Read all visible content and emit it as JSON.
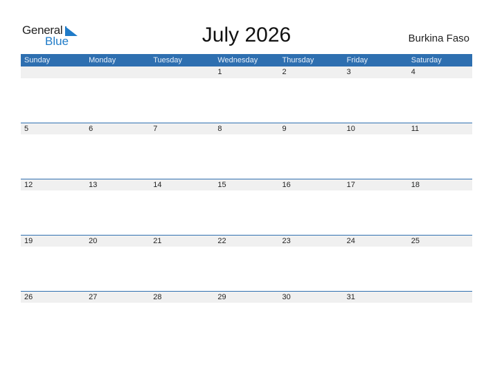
{
  "logo": {
    "word1": "General",
    "word2": "Blue"
  },
  "title": "July 2026",
  "country": "Burkina Faso",
  "colors": {
    "accent": "#2e6fb0",
    "logo_blue": "#1f7bc8",
    "strip": "#f0f0f0"
  },
  "days": [
    "Sunday",
    "Monday",
    "Tuesday",
    "Wednesday",
    "Thursday",
    "Friday",
    "Saturday"
  ],
  "weeks": [
    [
      "",
      "",
      "",
      "1",
      "2",
      "3",
      "4"
    ],
    [
      "5",
      "6",
      "7",
      "8",
      "9",
      "10",
      "11"
    ],
    [
      "12",
      "13",
      "14",
      "15",
      "16",
      "17",
      "18"
    ],
    [
      "19",
      "20",
      "21",
      "22",
      "23",
      "24",
      "25"
    ],
    [
      "26",
      "27",
      "28",
      "29",
      "30",
      "31",
      ""
    ]
  ]
}
